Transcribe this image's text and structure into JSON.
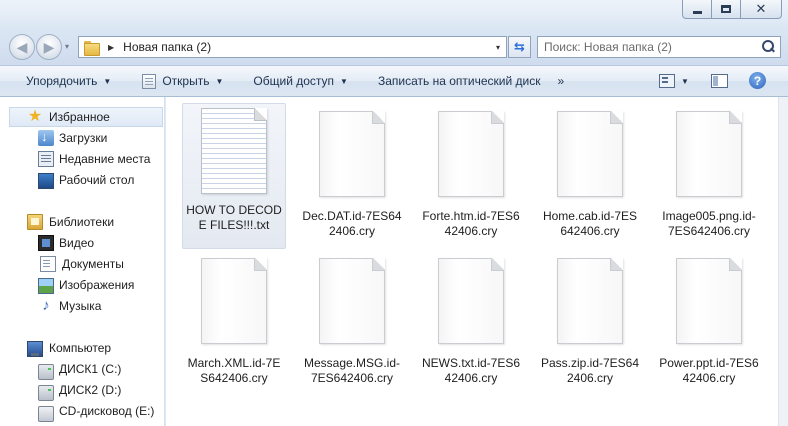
{
  "window": {
    "minimize_glyph": "",
    "close_glyph": "✕"
  },
  "navigation": {
    "back_glyph": "◀",
    "forward_glyph": "▶",
    "history_dropdown_glyph": "▾",
    "breadcrumb_arrow": "▶",
    "path": "Новая папка (2)",
    "address_dropdown_glyph": "▾",
    "refresh_glyph": "⇆"
  },
  "search": {
    "placeholder": "Поиск: Новая папка (2)"
  },
  "toolbar": {
    "organize_label": "Упорядочить",
    "open_label": "Открыть",
    "share_label": "Общий доступ",
    "burn_label": "Записать на оптический диск",
    "more_label": "»",
    "dropdown_glyph": "▼",
    "help_glyph": "?"
  },
  "sidebar": {
    "favorites": {
      "label": "Избранное",
      "icon": "star-icon",
      "items": [
        {
          "label": "Загрузки",
          "icon": "downloads-icon"
        },
        {
          "label": "Недавние места",
          "icon": "recent-places-icon"
        },
        {
          "label": "Рабочий стол",
          "icon": "desktop-icon"
        }
      ]
    },
    "libraries": {
      "label": "Библиотеки",
      "icon": "libraries-icon",
      "items": [
        {
          "label": "Видео",
          "icon": "video-icon"
        },
        {
          "label": "Документы",
          "icon": "documents-icon"
        },
        {
          "label": "Изображения",
          "icon": "pictures-icon"
        },
        {
          "label": "Музыка",
          "icon": "music-icon"
        }
      ]
    },
    "computer": {
      "label": "Компьютер",
      "icon": "computer-icon",
      "items": [
        {
          "label": "ДИСК1 (C:)",
          "icon": "drive-icon"
        },
        {
          "label": "ДИСК2 (D:)",
          "icon": "drive-icon"
        },
        {
          "label": "CD-дисковод (E:)",
          "icon": "cd-drive-icon"
        }
      ]
    }
  },
  "files": [
    {
      "name": "HOW TO DECODE FILES!!!.txt",
      "icon": "text-file-icon",
      "selected": true
    },
    {
      "name": "Dec.DAT.id-7ES642406.cry",
      "icon": "blank-file-icon"
    },
    {
      "name": "Forte.htm.id-7ES642406.cry",
      "icon": "blank-file-icon"
    },
    {
      "name": "Home.cab.id-7ES642406.cry",
      "icon": "blank-file-icon"
    },
    {
      "name": "Image005.png.id-7ES642406.cry",
      "icon": "blank-file-icon"
    },
    {
      "name": "March.XML.id-7ES642406.cry",
      "icon": "blank-file-icon"
    },
    {
      "name": "Message.MSG.id-7ES642406.cry",
      "icon": "blank-file-icon"
    },
    {
      "name": "NEWS.txt.id-7ES642406.cry",
      "icon": "blank-file-icon"
    },
    {
      "name": "Pass.zip.id-7ES642406.cry",
      "icon": "blank-file-icon"
    },
    {
      "name": "Power.ppt.id-7ES642406.cry",
      "icon": "blank-file-icon"
    }
  ]
}
